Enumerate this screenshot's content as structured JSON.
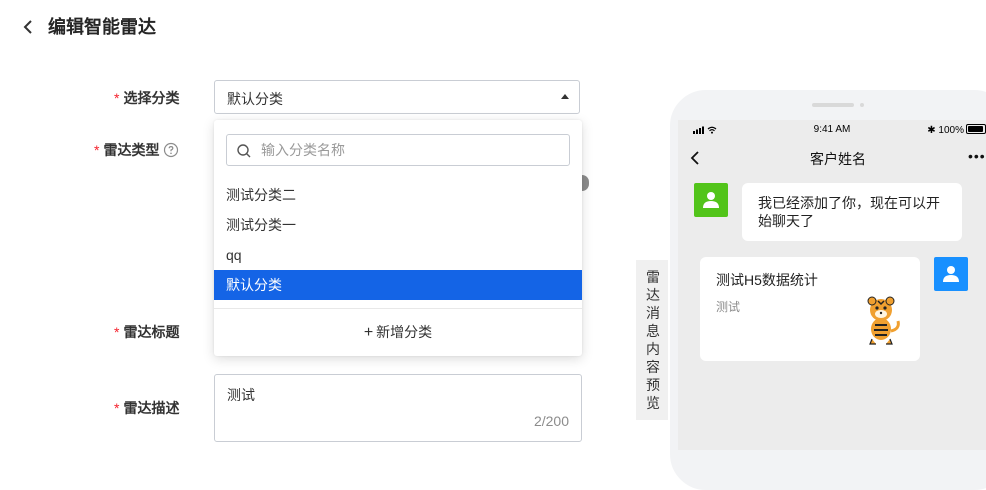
{
  "header": {
    "title": "编辑智能雷达"
  },
  "form": {
    "required_mark": "*",
    "category_label": "选择分类",
    "category_value": "默认分类",
    "type_label": "雷达类型",
    "title_label": "雷达标题",
    "desc_label": "雷达描述",
    "desc_value": "测试",
    "desc_count": "2/200"
  },
  "dropdown": {
    "search_placeholder": "输入分类名称",
    "options": [
      "测试分类二",
      "测试分类一",
      "qq",
      "默认分类"
    ],
    "selected_index": 3,
    "add_label": "新增分类"
  },
  "preview": {
    "tab_label": "雷达消息内容预览",
    "status_time": "9:41 AM",
    "battery": "100%",
    "chat_title": "客户姓名",
    "more": "•••",
    "message": "我已经添加了你，现在可以开始聊天了",
    "card_title": "测试H5数据统计",
    "card_desc": "测试"
  },
  "colors": {
    "primary": "#1464e6",
    "required": "#f5222d",
    "avatar_green": "#52c41a",
    "avatar_blue": "#1890ff"
  }
}
